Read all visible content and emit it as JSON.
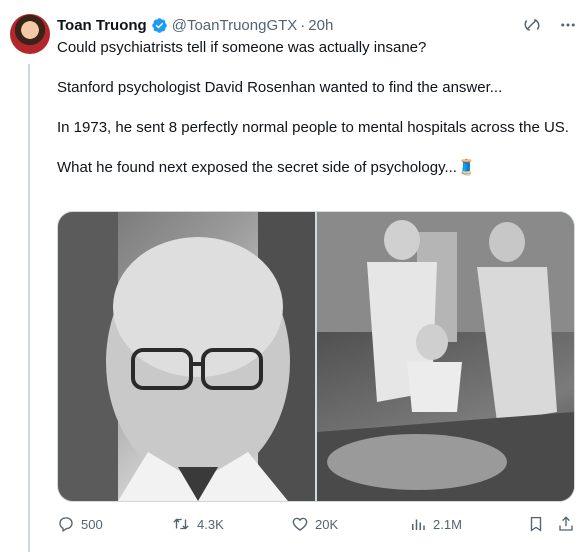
{
  "tweet": {
    "author_name": "Toan Truong",
    "handle": "@ToanTruongGTX",
    "separator": "·",
    "time": "20h",
    "paragraphs": [
      "Could psychiatrists tell if someone was actually insane?",
      "Stanford psychologist David Rosenhan wanted to find the answer...",
      "In 1973, he sent 8 perfectly normal people to mental hospitals across the US.",
      "What he found next exposed the secret side of psychology...🧵"
    ]
  },
  "media": [
    {
      "name": "portrait-photo",
      "icon": "photo"
    },
    {
      "name": "hospital-scene-photo",
      "icon": "photo"
    }
  ],
  "actions": {
    "replies": "500",
    "reposts": "4.3K",
    "likes": "20K",
    "views": "2.1M"
  },
  "colors": {
    "text": "#0f1419",
    "secondary": "#536471",
    "verified": "#1d9bf0",
    "border": "#cfd9de"
  }
}
